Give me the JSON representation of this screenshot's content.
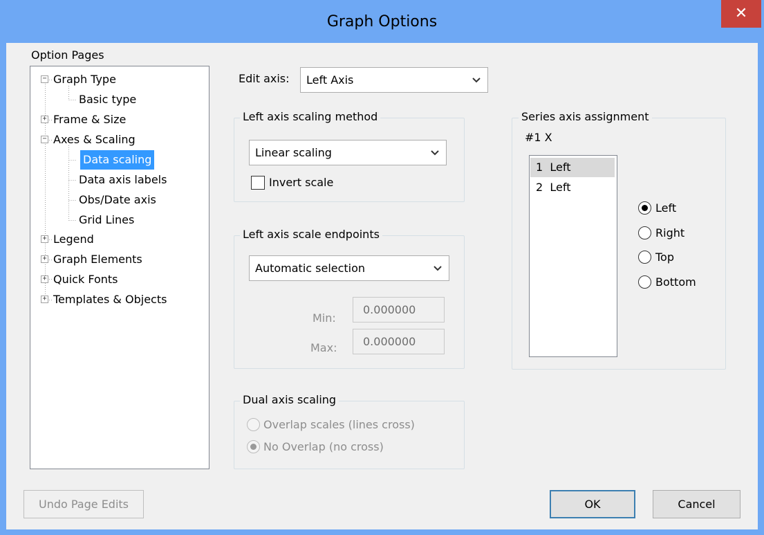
{
  "window": {
    "title": "Graph Options",
    "close_glyph": "✕"
  },
  "option_pages": {
    "label": "Option Pages",
    "items": [
      {
        "label": "Graph Type",
        "expander": "−"
      },
      {
        "label": "Basic type"
      },
      {
        "label": "Frame & Size",
        "expander": "+"
      },
      {
        "label": "Axes & Scaling",
        "expander": "−"
      },
      {
        "label": "Data scaling",
        "selected": true
      },
      {
        "label": "Data axis labels"
      },
      {
        "label": "Obs/Date axis"
      },
      {
        "label": "Grid Lines"
      },
      {
        "label": "Legend",
        "expander": "+"
      },
      {
        "label": "Graph Elements",
        "expander": "+"
      },
      {
        "label": "Quick Fonts",
        "expander": "+"
      },
      {
        "label": "Templates & Objects",
        "expander": "+"
      }
    ]
  },
  "edit_axis": {
    "label": "Edit axis:",
    "value": "Left Axis"
  },
  "scaling_method": {
    "title": "Left axis scaling method",
    "value": "Linear scaling",
    "invert_label": "Invert scale",
    "invert_checked": false
  },
  "endpoints": {
    "title": "Left axis scale endpoints",
    "value": "Automatic selection",
    "min_label": "Min:",
    "min_value": "0.000000",
    "max_label": "Max:",
    "max_value": "0.000000"
  },
  "dual_axis": {
    "title": "Dual axis scaling",
    "options": [
      {
        "label": "Overlap scales  (lines cross)",
        "checked": false
      },
      {
        "label": "No Overlap (no cross)",
        "checked": true
      }
    ]
  },
  "series_assignment": {
    "title": "Series axis assignment",
    "header": "#1  X",
    "list": [
      {
        "num": "1",
        "axis": "Left",
        "selected": true
      },
      {
        "num": "2",
        "axis": "Left",
        "selected": false
      }
    ],
    "radios": [
      {
        "label": "Left",
        "checked": true
      },
      {
        "label": "Right",
        "checked": false
      },
      {
        "label": "Top",
        "checked": false
      },
      {
        "label": "Bottom",
        "checked": false
      }
    ]
  },
  "buttons": {
    "undo": "Undo Page Edits",
    "ok": "OK",
    "cancel": "Cancel"
  },
  "icons": {
    "chevron": "chevron-down-icon",
    "close": "close-icon"
  }
}
